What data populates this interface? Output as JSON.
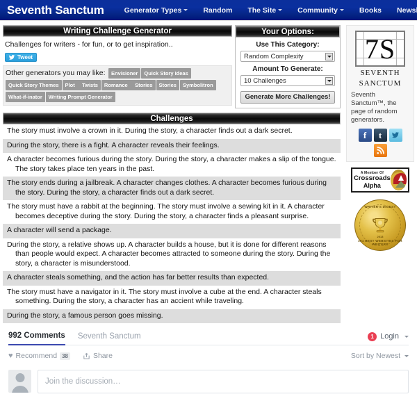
{
  "nav": {
    "brand": "Seventh Sanctum",
    "items": [
      {
        "label": "Generator Types",
        "caret": true
      },
      {
        "label": "Random",
        "caret": false
      },
      {
        "label": "The Site",
        "caret": true
      },
      {
        "label": "Community",
        "caret": true
      },
      {
        "label": "Books",
        "caret": false
      },
      {
        "label": "Newsletter",
        "caret": false
      }
    ]
  },
  "generator": {
    "title": "Writing Challenge Generator",
    "tagline": "Challenges for writers - for fun, or to get inspiration..",
    "tweet_label": "Tweet",
    "other_label": "Other generators you may like:",
    "other_tags": [
      "Envisioner",
      "Quick Story Ideas",
      "Quick Story Themes",
      "Plot     Twists",
      "Romance     Stories",
      "Stories",
      "Symbolitron",
      "What-if-inator",
      "Writing Prompt Generator"
    ]
  },
  "options": {
    "header": "Your Options:",
    "category_label": "Use This Category:",
    "category_value": "Random Complexity",
    "amount_label": "Amount To Generate:",
    "amount_value": "10 Challenges",
    "generate_button": "Generate More Challenges!"
  },
  "challenges": {
    "header": "Challenges",
    "items": [
      "The story must involve a crown in it. During the story, a character finds out a dark secret.",
      "During the story, there is a fight. A character reveals their feelings.",
      "A character becomes furious during the story. During the story, a character makes a slip of the tongue. The story takes place ten years in the past.",
      "The story ends during a jailbreak. A character changes clothes. A character becomes furious during the story. During the story, a character finds out a dark secret.",
      "The story must have a rabbit at the beginning. The story must involve a sewing kit in it. A character becomes deceptive during the story. During the story, a character finds a pleasant surprise.",
      "A character will send a package.",
      "During the story, a relative shows up. A character builds a house, but it is done for different reasons than people would expect. A character becomes attracted to someone during the story. During the story, a character is misunderstood.",
      "A character steals something, and the action has far better results than expected.",
      "The story must have a navigator in it. The story must involve a cube at the end. A character steals something. During the story, a character has an accient while traveling.",
      "During the story, a famous person goes missing."
    ]
  },
  "sidebar": {
    "logo_mark": "7S",
    "logo_line1": "SEVENTH",
    "logo_line2": "SANCTUM",
    "description": "Seventh Sanctum™, the page of random generators.",
    "social": [
      {
        "name": "facebook-icon",
        "glyph": "f"
      },
      {
        "name": "tumblr-icon",
        "glyph": "t"
      },
      {
        "name": "twitter-icon",
        "glyph": "ᵗ"
      }
    ],
    "rss": {
      "name": "rss-icon"
    },
    "crossroads": {
      "line1": "A Member Of",
      "line2": "Crossroads",
      "line3": "Alpha"
    },
    "seal": {
      "top": "WRITER'S DIGEST",
      "bottom": "101 BEST WEBSITES FOR WRITERS",
      "year": "2013"
    }
  },
  "comments": {
    "count_label": "992 Comments",
    "site_label": "Seventh Sanctum",
    "login_badge": "1",
    "login_label": "Login",
    "recommend_label": "Recommend",
    "recommend_count": "38",
    "share_label": "Share",
    "sort_label": "Sort by Newest",
    "compose_placeholder": "Join the discussion…"
  },
  "colors": {
    "nav_blue": "#0a2f9e",
    "accent_red": "#ea3f53",
    "tab_underline": "#3c4ab0",
    "tag_gray": "#9a9a9a",
    "row_alt": "#dddddd",
    "twitter_blue": "#2a9fdd"
  }
}
